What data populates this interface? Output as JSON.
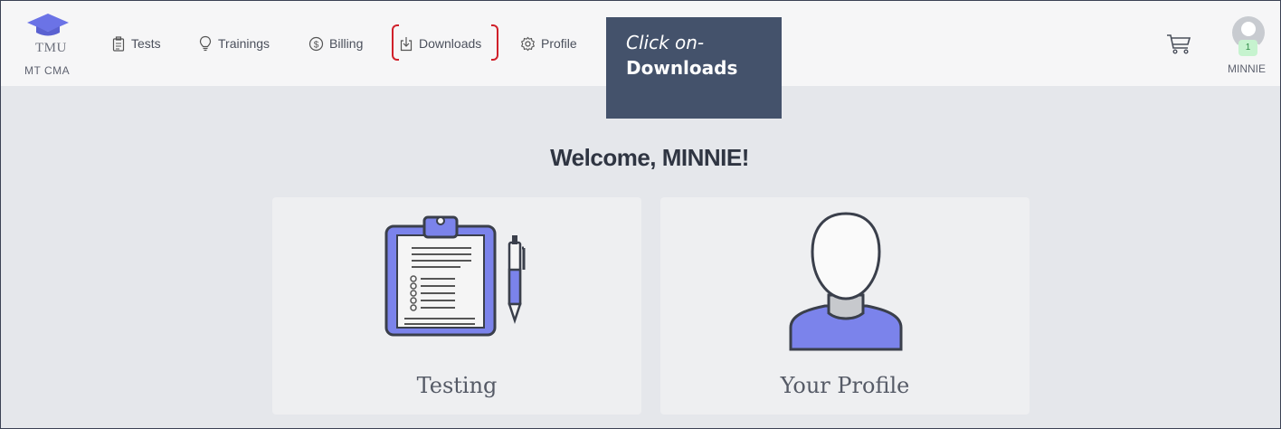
{
  "brand": {
    "logo_text": "TMU",
    "org_name": "MT CMA"
  },
  "nav": [
    {
      "label": "Tests",
      "icon": "clipboard-icon"
    },
    {
      "label": "Trainings",
      "icon": "lightbulb-icon"
    },
    {
      "label": "Billing",
      "icon": "dollar-circle-icon"
    },
    {
      "label": "Downloads",
      "icon": "download-icon"
    },
    {
      "label": "Profile",
      "icon": "gear-icon"
    }
  ],
  "callout": {
    "line1": "Click on-",
    "line2": "Downloads"
  },
  "user": {
    "name": "MINNIE",
    "badge_count": "1"
  },
  "main": {
    "welcome": "Welcome, MINNIE!",
    "cards": [
      {
        "label": "Testing",
        "icon": "clipboard-pen-icon"
      },
      {
        "label": "Your Profile",
        "icon": "person-icon"
      }
    ]
  },
  "colors": {
    "accent": "#7b83eb",
    "highlight": "#d0202a",
    "callout_bg": "#44526b"
  }
}
